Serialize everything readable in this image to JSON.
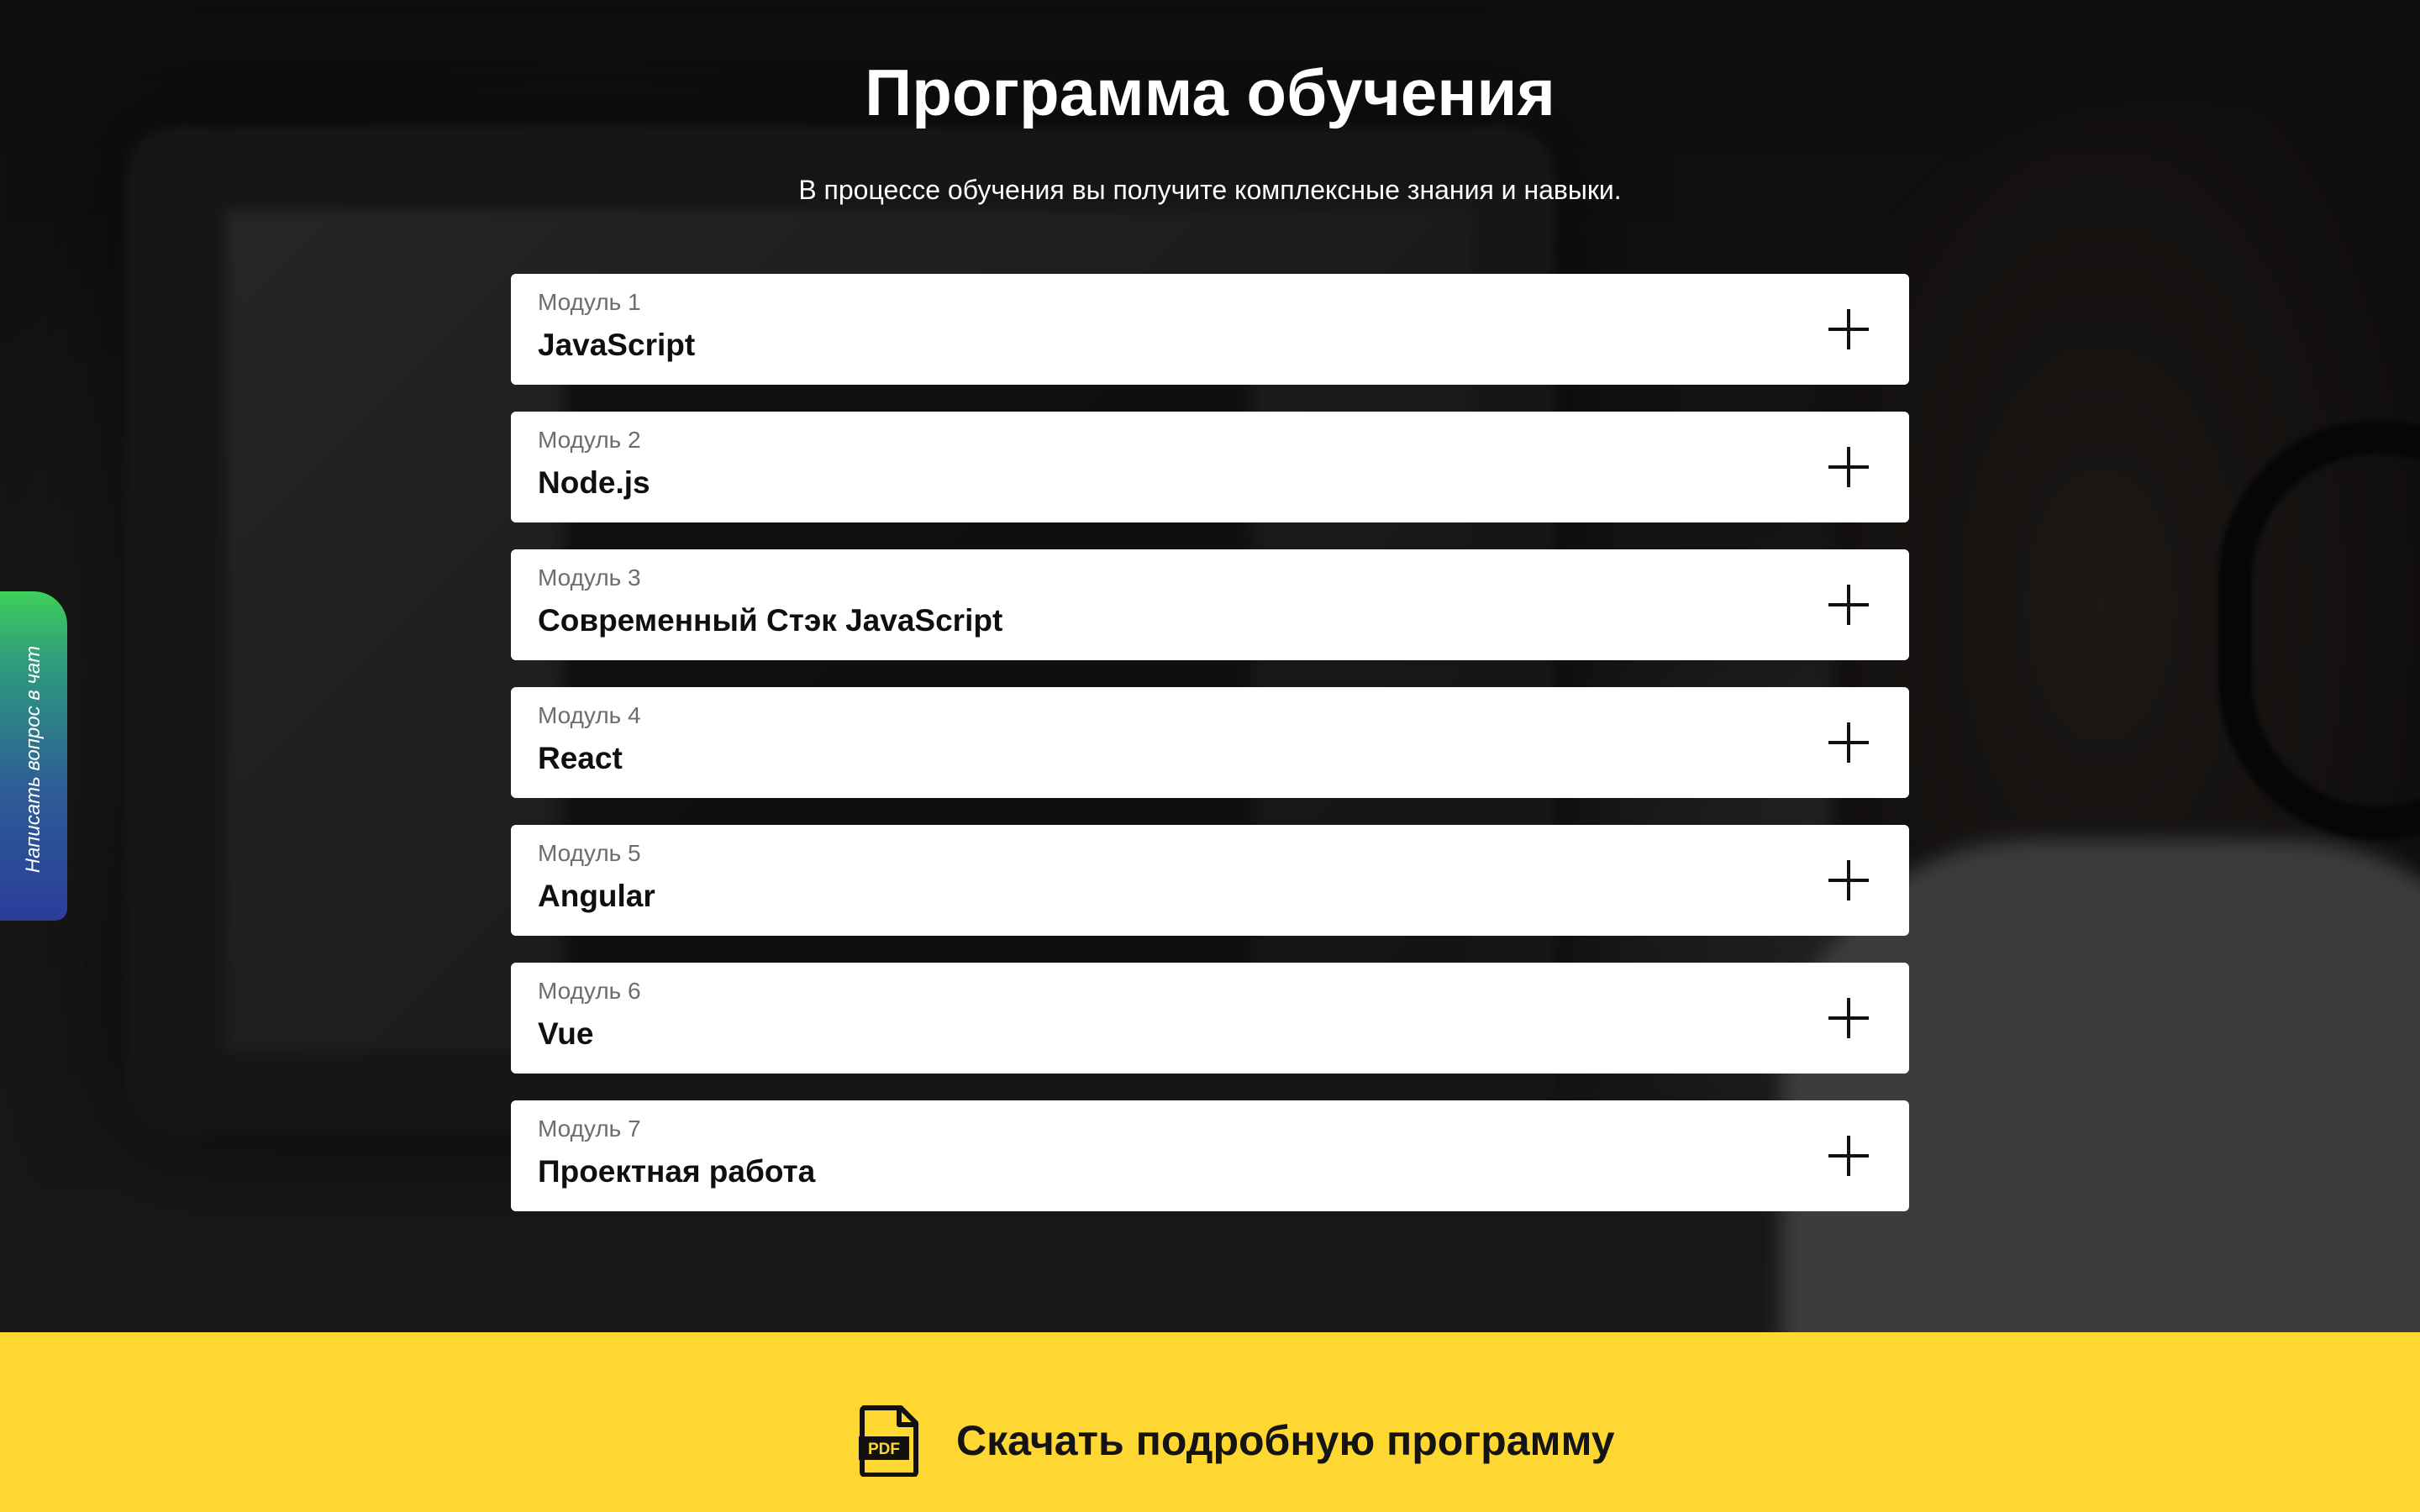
{
  "section": {
    "title": "Программа обучения",
    "subtitle": "В процессе обучения вы получите комплексные знания и навыки."
  },
  "modules": [
    {
      "label": "Модуль 1",
      "title": "JavaScript",
      "icon": "plus-icon"
    },
    {
      "label": "Модуль 2",
      "title": "Node.js",
      "icon": "plus-icon"
    },
    {
      "label": "Модуль 3",
      "title": "Современный Стэк JavaScript",
      "icon": "plus-icon"
    },
    {
      "label": "Модуль 4",
      "title": "React",
      "icon": "plus-icon"
    },
    {
      "label": "Модуль 5",
      "title": "Angular",
      "icon": "plus-icon"
    },
    {
      "label": "Модуль 6",
      "title": "Vue",
      "icon": "plus-icon"
    },
    {
      "label": "Модуль 7",
      "title": "Проектная работа",
      "icon": "plus-icon"
    }
  ],
  "chat_widget": {
    "label": "Написать вопрос в чат"
  },
  "download": {
    "label": "Скачать подробную программу",
    "icon": "pdf-file-icon",
    "icon_text": "PDF"
  },
  "colors": {
    "band": "#ffd733",
    "card": "#ffffff",
    "chat_gradient_top": "#3ecf5a",
    "chat_gradient_bottom": "#2a3d9a"
  }
}
